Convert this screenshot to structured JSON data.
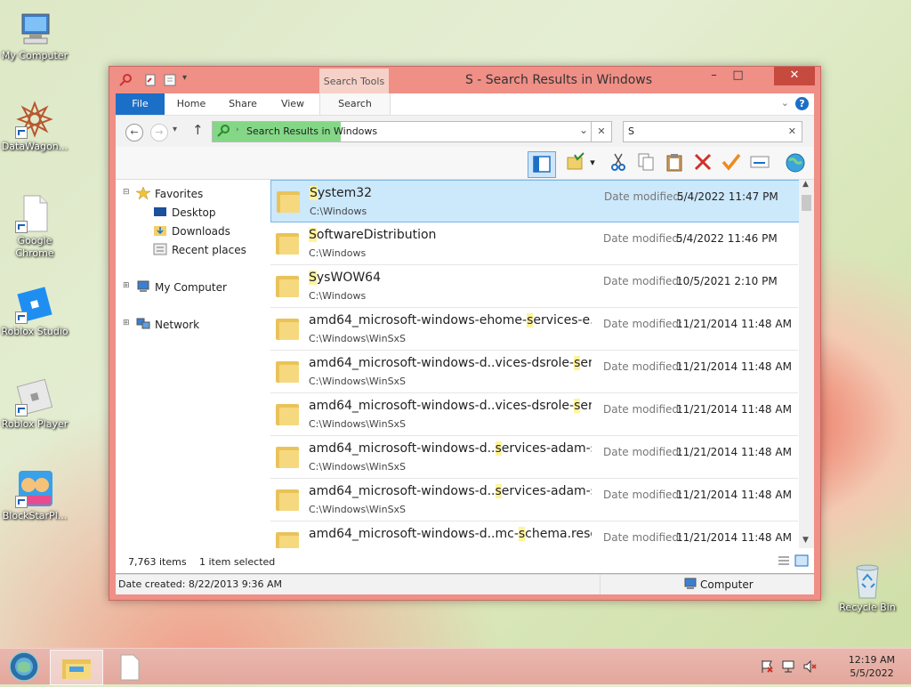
{
  "desktop_icons": [
    {
      "label": "My Computer",
      "icon": "computer-icon"
    },
    {
      "label": "DataWagon...",
      "icon": "datawagon-icon"
    },
    {
      "label": "Google Chrome",
      "icon": "blank-file-icon"
    },
    {
      "label": "Roblox Studio",
      "icon": "roblox-studio-icon"
    },
    {
      "label": "Roblox Player",
      "icon": "roblox-player-icon"
    },
    {
      "label": "BlockStarPl...",
      "icon": "blockstar-icon"
    },
    {
      "label": "Recycle Bin",
      "icon": "recycle-bin-icon"
    }
  ],
  "window": {
    "title": "S - Search Results in Windows",
    "contextual_tab": "Search Tools",
    "minimize": "–",
    "maximize": "□",
    "close": "✕"
  },
  "ribbon": {
    "tabs": [
      "File",
      "Home",
      "Share",
      "View",
      "Search"
    ],
    "help": "?"
  },
  "address_bar": {
    "path": "Search Results in Windows",
    "search_value": "S",
    "clear": "✕"
  },
  "nav_pane": {
    "favorites": "Favorites",
    "favorites_items": [
      "Desktop",
      "Downloads",
      "Recent places"
    ],
    "computer": "My Computer",
    "network": "Network"
  },
  "results": {
    "date_label": "Date modified:",
    "items": [
      {
        "pre": "",
        "hl": "S",
        "post": "ystem32",
        "path": "C:\\Windows",
        "date": "5/4/2022 11:47 PM",
        "selected": true
      },
      {
        "pre": "",
        "hl": "S",
        "post": "oftwareDistribution",
        "path": "C:\\Windows",
        "date": "5/4/2022 11:46 PM"
      },
      {
        "pre": "",
        "hl": "S",
        "post": "ysWOW64",
        "path": "C:\\Windows",
        "date": "10/5/2021 2:10 PM"
      },
      {
        "pre": "amd64_microsoft-windows-ehome-",
        "hl": "s",
        "post": "ervices-e...",
        "path": "C:\\Windows\\WinSxS",
        "date": "11/21/2014 11:48 AM"
      },
      {
        "pre": "amd64_microsoft-windows-d..vices-dsrole-",
        "hl": "s",
        "post": "er...",
        "path": "C:\\Windows\\WinSxS",
        "date": "11/21/2014 11:48 AM"
      },
      {
        "pre": "amd64_microsoft-windows-d..vices-dsrole-",
        "hl": "s",
        "post": "er...",
        "path": "C:\\Windows\\WinSxS",
        "date": "11/21/2014 11:48 AM"
      },
      {
        "pre": "amd64_microsoft-windows-d..",
        "hl": "s",
        "post": "ervices-adam-s...",
        "path": "C:\\Windows\\WinSxS",
        "date": "11/21/2014 11:48 AM"
      },
      {
        "pre": "amd64_microsoft-windows-d..",
        "hl": "s",
        "post": "ervices-adam-s...",
        "path": "C:\\Windows\\WinSxS",
        "date": "11/21/2014 11:48 AM"
      },
      {
        "pre": "amd64_microsoft-windows-d..mc-",
        "hl": "s",
        "post": "chema.reso...",
        "path": "C:\\Windows\\WinSxS",
        "date": "11/21/2014 11:48 AM"
      }
    ]
  },
  "status": {
    "count": "7,763 items",
    "selected": "1 item selected",
    "date_created": "Date created: 8/22/2013 9:36 AM",
    "location": "Computer"
  },
  "taskbar": {
    "time": "12:19 AM",
    "date": "5/5/2022"
  }
}
